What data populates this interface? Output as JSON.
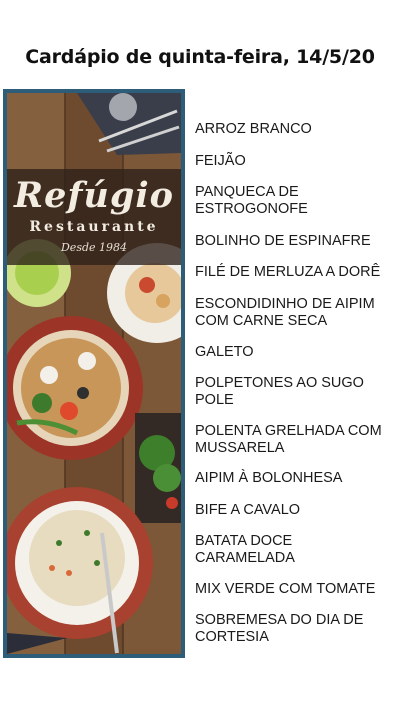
{
  "title": "Cardápio de quinta-feira, 14/5/20",
  "logo": {
    "name": "Refúgio",
    "subtitle": "Restaurante",
    "since": "Desde 1984"
  },
  "menu": [
    "ARROZ BRANCO",
    "FEIJÃO",
    "PANQUECA DE ESTROGONOFE",
    "BOLINHO DE ESPINAFRE",
    "FILÉ DE MERLUZA A DORÊ",
    "ESCONDIDINHO DE AIPIM COM CARNE SECA",
    "GALETO",
    "POLPETONES AO SUGO POLE",
    "POLENTA GRELHADA COM MUSSARELA",
    "AIPIM À BOLONHESA",
    "BIFE A CAVALO",
    "BATATA DOCE CARAMELADA",
    "MIX VERDE COM TOMATE",
    "SOBREMESA DO DIA DE CORTESIA"
  ],
  "colors": {
    "frame_border": "#2d5d78",
    "text": "#1a1a1a"
  }
}
